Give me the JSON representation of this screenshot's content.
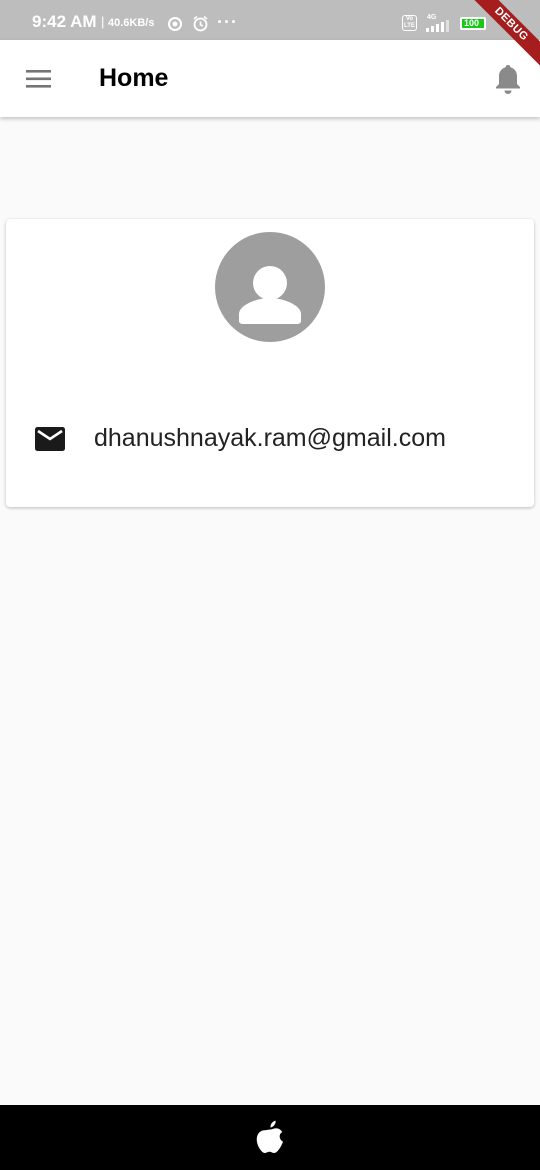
{
  "status_bar": {
    "time": "9:42 AM",
    "separator": "|",
    "net_speed": "40.6KB/s",
    "overflow_dots": "···",
    "volte_label": "Vo LTE",
    "network_type": "4G",
    "battery_level": "100",
    "battery_color": "#19c819",
    "icons": [
      "data-saver-icon",
      "alarm-icon",
      "volte-icon",
      "signal-icon",
      "battery-icon"
    ]
  },
  "debug_banner": {
    "label": "DEBUG",
    "color": "#a51d1d"
  },
  "app_bar": {
    "title": "Home",
    "leading_icon": "hamburger-menu-icon",
    "trailing_icon": "bell-icon"
  },
  "profile_card": {
    "avatar_icon": "person-icon",
    "email_icon": "email-icon",
    "email": "dhanushnayak.ram@gmail.com"
  },
  "nav_bar": {
    "icon": "apple-icon"
  }
}
